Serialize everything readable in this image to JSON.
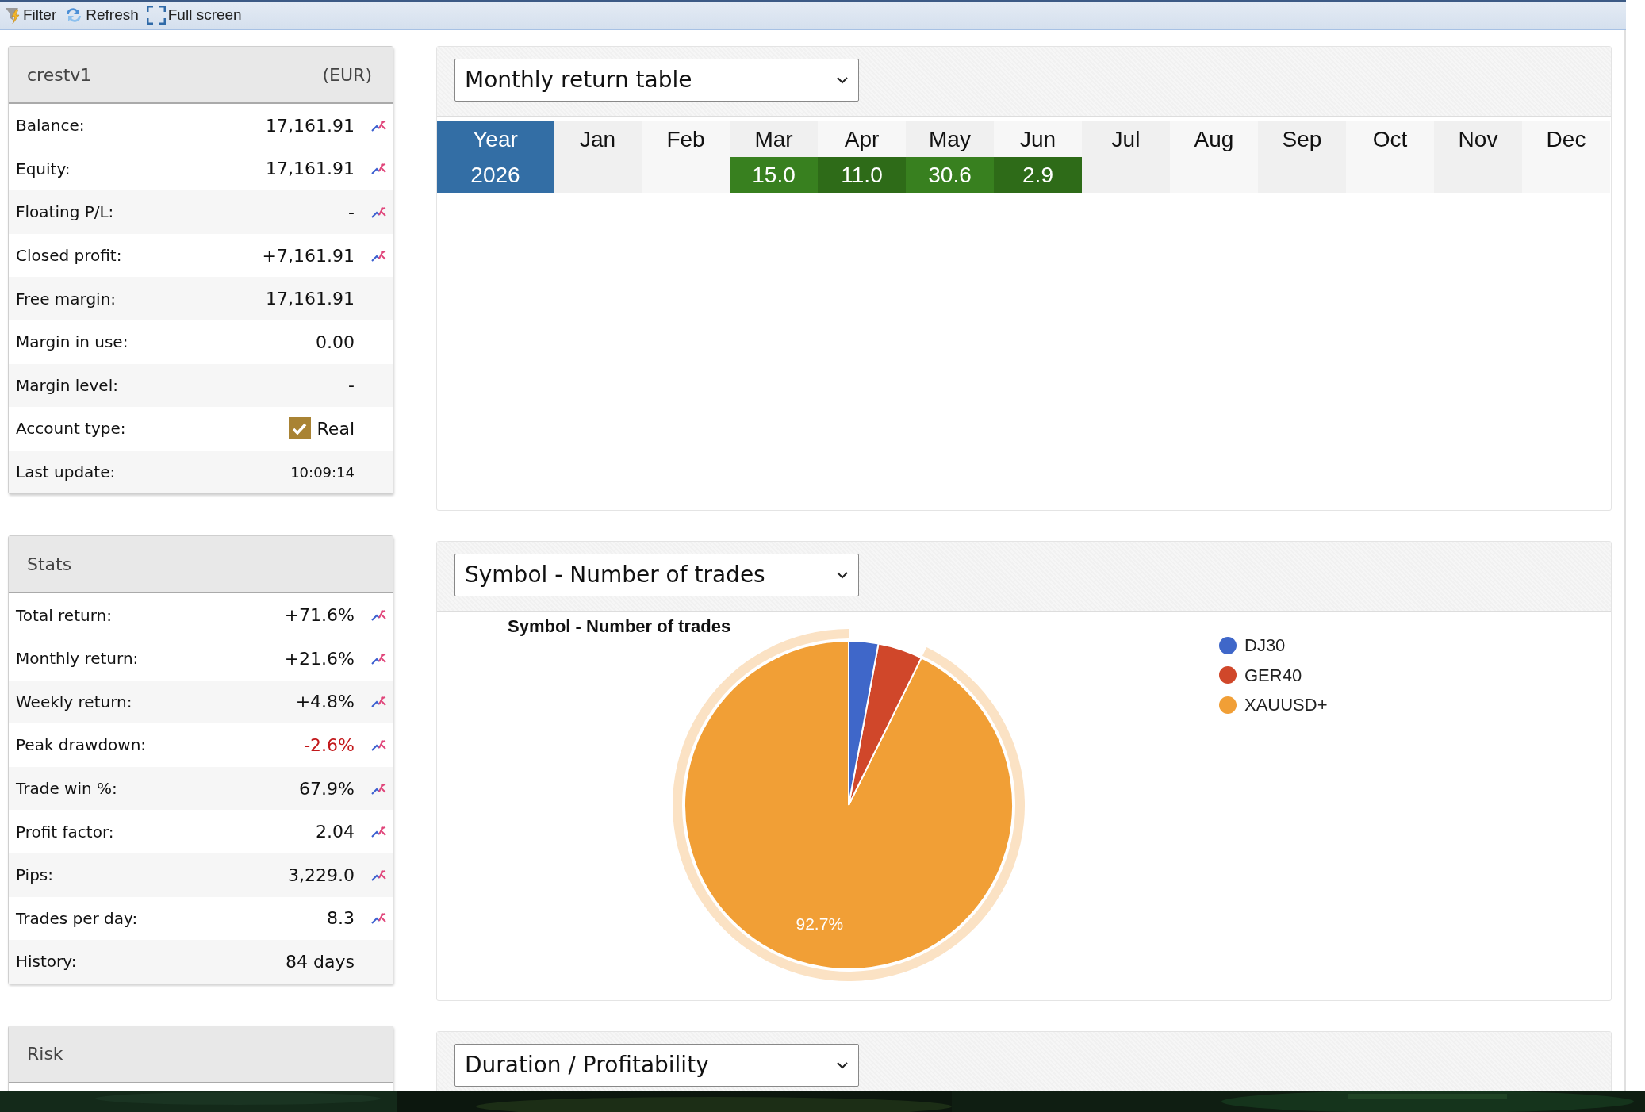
{
  "toolbar": [
    {
      "kind": "filter",
      "label": "Filter"
    },
    {
      "kind": "refresh",
      "label": "Refresh"
    },
    {
      "kind": "fullscreen",
      "label": "Full screen"
    }
  ],
  "account": {
    "title": "crestv1",
    "currency": "(EUR)",
    "rows": [
      {
        "kind": "value",
        "label": "Balance:",
        "value": "17,161.91",
        "chart": true
      },
      {
        "kind": "value",
        "label": "Equity:",
        "value": "17,161.91",
        "chart": true
      },
      {
        "kind": "value",
        "label": "Floating P/L:",
        "value": "-",
        "chart": true
      },
      {
        "kind": "value",
        "label": "Closed profit:",
        "value": "+7,161.91",
        "chart": true
      },
      {
        "kind": "value",
        "label": "Free margin:",
        "value": "17,161.91",
        "chart": false
      },
      {
        "kind": "value",
        "label": "Margin in use:",
        "value": "0.00",
        "chart": false
      },
      {
        "kind": "value",
        "label": "Margin level:",
        "value": "-",
        "chart": false
      },
      {
        "kind": "check",
        "label": "Account type:",
        "value": "Real",
        "checked": true,
        "chart": false
      },
      {
        "kind": "time",
        "label": "Last update:",
        "value": "10:09:14",
        "chart": false
      }
    ]
  },
  "stats": {
    "title": "Stats",
    "rows": [
      {
        "kind": "value",
        "label": "Total return:",
        "value": "+71.6%",
        "chart": true,
        "negative": false
      },
      {
        "kind": "value",
        "label": "Monthly return:",
        "value": "+21.6%",
        "chart": true,
        "negative": false
      },
      {
        "kind": "value",
        "label": "Weekly return:",
        "value": "+4.8%",
        "chart": true,
        "negative": false
      },
      {
        "kind": "value",
        "label": "Peak drawdown:",
        "value": "-2.6%",
        "chart": true,
        "negative": true
      },
      {
        "kind": "value",
        "label": "Trade win %:",
        "value": "67.9%",
        "chart": true,
        "negative": false
      },
      {
        "kind": "value",
        "label": "Profit factor:",
        "value": "2.04",
        "chart": true,
        "negative": false
      },
      {
        "kind": "value",
        "label": "Pips:",
        "value": "3,229.0",
        "chart": true,
        "negative": false
      },
      {
        "kind": "value",
        "label": "Trades per day:",
        "value": "8.3",
        "chart": true,
        "negative": false
      },
      {
        "kind": "value",
        "label": "History:",
        "value": "84 days",
        "chart": false,
        "negative": false
      }
    ]
  },
  "risk": {
    "title": "Risk"
  },
  "panels": [
    {
      "kind": "table",
      "dropdown": "Monthly return table",
      "table": {
        "columns": [
          "Year",
          "Jan",
          "Feb",
          "Mar",
          "Apr",
          "May",
          "Jun",
          "Jul",
          "Aug",
          "Sep",
          "Oct",
          "Nov",
          "Dec"
        ],
        "rows": [
          {
            "cells": [
              {
                "text": "2026"
              },
              {
                "text": ""
              },
              {
                "text": ""
              },
              {
                "text": "15.0",
                "color": "#38801f"
              },
              {
                "text": "11.0",
                "color": "#2e6b18"
              },
              {
                "text": "30.6",
                "color": "#38801f"
              },
              {
                "text": "2.9",
                "color": "#2e6b18"
              },
              {
                "text": ""
              },
              {
                "text": ""
              },
              {
                "text": ""
              },
              {
                "text": ""
              },
              {
                "text": ""
              },
              {
                "text": ""
              }
            ]
          }
        ]
      }
    },
    {
      "kind": "pie",
      "dropdown": "Symbol - Number of trades",
      "slice_highlighted": [
        false,
        false,
        true
      ],
      "chart_data": {
        "type": "pie",
        "title": "Symbol - Number of trades",
        "categories": [
          "DJ30",
          "GER40",
          "XAUUSD+"
        ],
        "series": [
          {
            "values": [
              2.9,
              4.4,
              92.7
            ]
          }
        ],
        "colors": [
          "#3f67c9",
          "#d0472a",
          "#f19f36"
        ],
        "value_labels": [
          null,
          null,
          "92.7%"
        ]
      }
    },
    {
      "kind": "empty",
      "dropdown": "Duration / Profitability"
    }
  ]
}
